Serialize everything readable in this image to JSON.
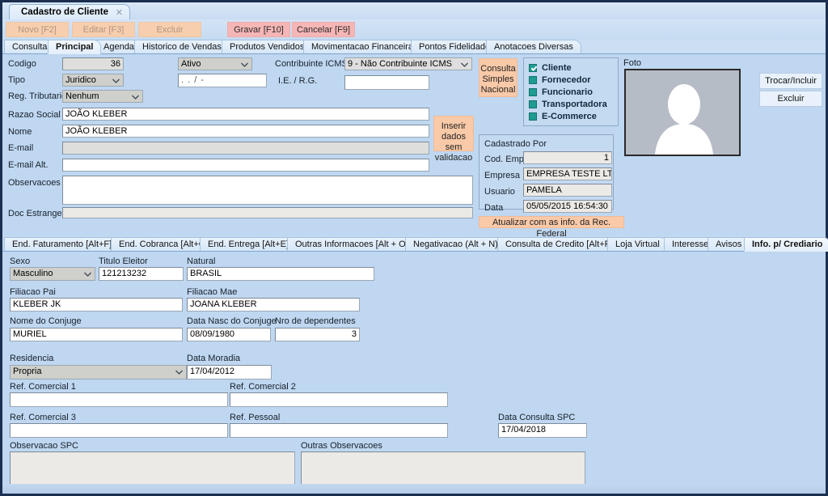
{
  "window": {
    "tab_title": "Cadastro de Cliente",
    "close_icon": "close-icon",
    "close_glyph": "✕"
  },
  "toolbar": {
    "buttons": [
      {
        "label": "Novo [F2]",
        "state": "disabled"
      },
      {
        "label": "Editar [F3]",
        "state": "disabled"
      },
      {
        "label": "Excluir",
        "state": "disabled"
      },
      {
        "label": "Gravar [F10]",
        "state": "active"
      },
      {
        "label": "Cancelar [F9]",
        "state": "active"
      }
    ]
  },
  "main_tabs": [
    {
      "label": "Consulta",
      "selected": false
    },
    {
      "label": "Principal",
      "selected": true
    },
    {
      "label": "Agenda",
      "selected": false
    },
    {
      "label": "Historico de Vendas",
      "selected": false
    },
    {
      "label": "Produtos Vendidos",
      "selected": false
    },
    {
      "label": "Movimentacao Financeira",
      "selected": false
    },
    {
      "label": "Pontos Fidelidade",
      "selected": false
    },
    {
      "label": "Anotacoes Diversas",
      "selected": false
    }
  ],
  "sub_tabs": [
    {
      "label": "End. Faturamento [Alt+F]",
      "selected": false
    },
    {
      "label": "End. Cobranca [Alt+C]",
      "selected": false
    },
    {
      "label": "End. Entrega [Alt+E]",
      "selected": false
    },
    {
      "label": "Outras Informacoes [Alt + O]",
      "selected": false
    },
    {
      "label": "Negativacao (Alt + N)",
      "selected": false
    },
    {
      "label": "Consulta de Credito [Alt+R]",
      "selected": false
    },
    {
      "label": "Loja Virtual",
      "selected": false
    },
    {
      "label": "Interesse",
      "selected": false
    },
    {
      "label": "Avisos",
      "selected": false
    },
    {
      "label": "Info. p/ Crediario",
      "selected": true
    }
  ],
  "principal": {
    "codigo": {
      "label": "Codigo",
      "value": "36"
    },
    "tipo": {
      "label": "Tipo",
      "value": "Juridico"
    },
    "reg_tributario": {
      "label": "Reg. Tributario",
      "value": "Nenhum"
    },
    "razao_social": {
      "label": "Razao Social",
      "value": "JOÃO KLEBER"
    },
    "nome": {
      "label": "Nome",
      "value": "JOÃO KLEBER"
    },
    "email": {
      "label": "E-mail",
      "value": ""
    },
    "email_alt": {
      "label": "E-mail Alt.",
      "value": ""
    },
    "observacoes": {
      "label": "Observacoes",
      "value": ""
    },
    "doc_estrangeiro": {
      "label": "Doc Estrangeiro",
      "value": ""
    },
    "status": {
      "label": "Status",
      "value": "Ativo"
    },
    "cnpj_cpf": {
      "label": "CNPJ / CPF",
      "value": ".   .   /    -"
    },
    "contribuinte_icms": {
      "label": "Contribuinte ICMS",
      "value": "9 - Não Contribuinte ICMS"
    },
    "ie_rg": {
      "label": "I.E. / R.G.",
      "value": ""
    }
  },
  "actions": {
    "consulta_simples_nacional": "Consulta\nSimples\nNacional",
    "inserir_dados_sem_validacao": "Inserir\ndados sem\nvalidacao",
    "atualizar_rec_federal": "Atualizar com as info. da Rec. Federal"
  },
  "tipos": {
    "items": [
      {
        "label": "Cliente",
        "checked": true
      },
      {
        "label": "Fornecedor",
        "checked": false
      },
      {
        "label": "Funcionario",
        "checked": false
      },
      {
        "label": "Transportadora",
        "checked": false
      },
      {
        "label": "E-Commerce",
        "checked": false
      }
    ]
  },
  "cadastrado_por": {
    "title": "Cadastrado Por",
    "cod_emp": {
      "label": "Cod. Emp",
      "value": "1"
    },
    "empresa": {
      "label": "Empresa",
      "value": "EMPRESA TESTE LTDA"
    },
    "usuario": {
      "label": "Usuario",
      "value": "PAMELA"
    },
    "data": {
      "label": "Data",
      "value": "05/05/2015 16:54:30"
    }
  },
  "foto": {
    "label": "Foto",
    "placeholder_icon": "person-silhouette-icon",
    "trocar_incluir": "Trocar/Incluir",
    "excluir": "Excluir"
  },
  "crediario": {
    "sexo": {
      "label": "Sexo",
      "value": "Masculino"
    },
    "titulo_eleitor": {
      "label": "Titulo Eleitor",
      "value": "121213232"
    },
    "natural": {
      "label": "Natural",
      "value": "BRASIL"
    },
    "filiacao_pai": {
      "label": "Filiacao Pai",
      "value": "KLEBER JK"
    },
    "filiacao_mae": {
      "label": "Filiacao Mae",
      "value": "JOANA KLEBER"
    },
    "nome_conjuge": {
      "label": "Nome do Conjuge",
      "value": "MURIEL"
    },
    "data_nasc_conjuge": {
      "label": "Data Nasc do Conjuge",
      "value": "08/09/1980"
    },
    "nro_dependentes": {
      "label": "Nro de dependentes",
      "value": "3"
    },
    "residencia": {
      "label": "Residencia",
      "value": "Propria"
    },
    "data_moradia": {
      "label": "Data Moradia",
      "value": "17/04/2012"
    },
    "ref_comercial_1": {
      "label": "Ref. Comercial 1",
      "value": ""
    },
    "ref_comercial_2": {
      "label": "Ref. Comercial 2",
      "value": ""
    },
    "ref_comercial_3": {
      "label": "Ref. Comercial 3",
      "value": ""
    },
    "ref_pessoal": {
      "label": "Ref. Pessoal",
      "value": ""
    },
    "data_consulta_spc": {
      "label": "Data Consulta SPC",
      "value": "17/04/2018"
    },
    "observacao_spc": {
      "label": "Observacao SPC",
      "value": ""
    },
    "outras_observacoes": {
      "label": "Outras Observacoes",
      "value": ""
    }
  },
  "colors": {
    "frame_border": "#1b3050",
    "panel_bg": "#bfd7f0",
    "action_orange": "#f9c9a8",
    "action_pink": "#f6b6b6",
    "checkbox_teal": "#1f9c93"
  }
}
